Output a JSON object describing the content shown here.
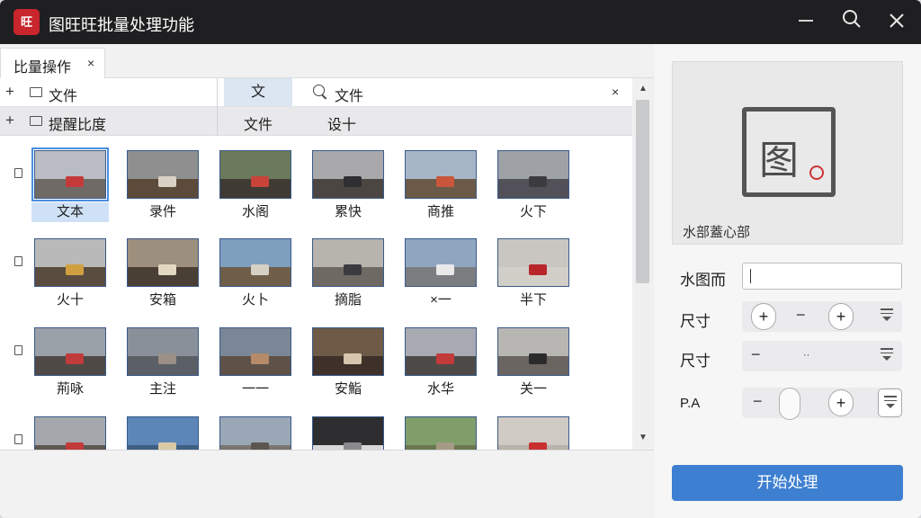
{
  "app": {
    "logo_text": "旺",
    "title": "图旺旺批量处理功能"
  },
  "window_controls": {
    "minimize": "—",
    "search": "search",
    "close": "✕"
  },
  "tab": {
    "label": "比量操作",
    "close": "×"
  },
  "filter_rows": [
    {
      "plus": "+",
      "label": "文件",
      "chip": "文",
      "search": "文件",
      "clear": "×"
    },
    {
      "plus": "+",
      "label": "提醒比度",
      "col2": "文件",
      "col3": "设十"
    }
  ],
  "thumbnails": [
    [
      {
        "caption": "文本",
        "selected": true,
        "sky": "#b9bcc2",
        "floor": "#6f6a66",
        "obj": "#c43a3a"
      },
      {
        "caption": "录件",
        "selected": false,
        "sky": "#8f8f8f",
        "floor": "#5c4a3a",
        "obj": "#d9d2c4"
      },
      {
        "caption": "水阁",
        "selected": false,
        "sky": "#6b7a5c",
        "floor": "#3f3a34",
        "obj": "#c9433b"
      },
      {
        "caption": "累快",
        "selected": false,
        "sky": "#a9a9ab",
        "floor": "#4c4643",
        "obj": "#2f2f33"
      },
      {
        "caption": "商推",
        "selected": false,
        "sky": "#a7b6c6",
        "floor": "#6b5a48",
        "obj": "#c9563a"
      },
      {
        "caption": "火下",
        "selected": false,
        "sky": "#9ea1a6",
        "floor": "#525058",
        "obj": "#3c3c40"
      }
    ],
    [
      {
        "caption": "火十",
        "selected": false,
        "sky": "#b9b9b9",
        "floor": "#5a4c3e",
        "obj": "#d0a040"
      },
      {
        "caption": "安箱",
        "selected": false,
        "sky": "#9c8f7e",
        "floor": "#4a3f34",
        "obj": "#e3d8c2"
      },
      {
        "caption": "火卜",
        "selected": false,
        "sky": "#7f9fbf",
        "floor": "#6f5f4a",
        "obj": "#d7d0c4"
      },
      {
        "caption": "摘脂",
        "selected": false,
        "sky": "#b7b4ae",
        "floor": "#6e6a63",
        "obj": "#3a3a3f"
      },
      {
        "caption": "×一",
        "selected": false,
        "sky": "#8fa6c0",
        "floor": "#7c7d80",
        "obj": "#e9e9ea"
      },
      {
        "caption": "半下",
        "selected": false,
        "sky": "#c9c6c1",
        "floor": "#d2cec8",
        "obj": "#b8262c"
      }
    ],
    [
      {
        "caption": "荊咏",
        "selected": false,
        "sky": "#9aa0a7",
        "floor": "#4f4a46",
        "obj": "#c23b3b"
      },
      {
        "caption": "主注",
        "selected": false,
        "sky": "#8a9099",
        "floor": "#5b5f66",
        "obj": "#9b8f86"
      },
      {
        "caption": "一一",
        "selected": false,
        "sky": "#7b8796",
        "floor": "#5e5248",
        "obj": "#b58b6a"
      },
      {
        "caption": "安鮨",
        "selected": false,
        "sky": "#6e5a46",
        "floor": "#3d3129",
        "obj": "#d7c6ad"
      },
      {
        "caption": "水华",
        "selected": false,
        "sky": "#a7abb1",
        "floor": "#4e4a48",
        "obj": "#c23a3a"
      },
      {
        "caption": "关一",
        "selected": false,
        "sky": "#b8b6b2",
        "floor": "#6b6561",
        "obj": "#2b2b2e"
      }
    ],
    [
      {
        "caption": "",
        "selected": false,
        "sky": "#a4a7ab",
        "floor": "#5e5751",
        "obj": "#c23a3a"
      },
      {
        "caption": "",
        "selected": false,
        "sky": "#5c86b8",
        "floor": "#3e5f82",
        "obj": "#d9c9a6"
      },
      {
        "caption": "",
        "selected": false,
        "sky": "#9aa7b6",
        "floor": "#7a7670",
        "obj": "#5c5650"
      },
      {
        "caption": "",
        "selected": false,
        "sky": "#2e2e30",
        "floor": "#d9d9da",
        "obj": "#8a8a8c"
      },
      {
        "caption": "",
        "selected": false,
        "sky": "#7f9e6a",
        "floor": "#6a7750",
        "obj": "#a59a86"
      },
      {
        "caption": "",
        "selected": false,
        "sky": "#cfcac4",
        "floor": "#b8b2aa",
        "obj": "#c83030"
      }
    ]
  ],
  "preview": {
    "glyph": "图",
    "caption": "水部蓋心部"
  },
  "properties": {
    "watermark_label": "水图而",
    "watermark_value": "",
    "size1_label": "尺寸",
    "size2_label": "尺寸",
    "pa_label": "P.A"
  },
  "controls": {
    "plus": "+",
    "minus": "−",
    "dots": "··"
  },
  "start_button": "开始处理"
}
